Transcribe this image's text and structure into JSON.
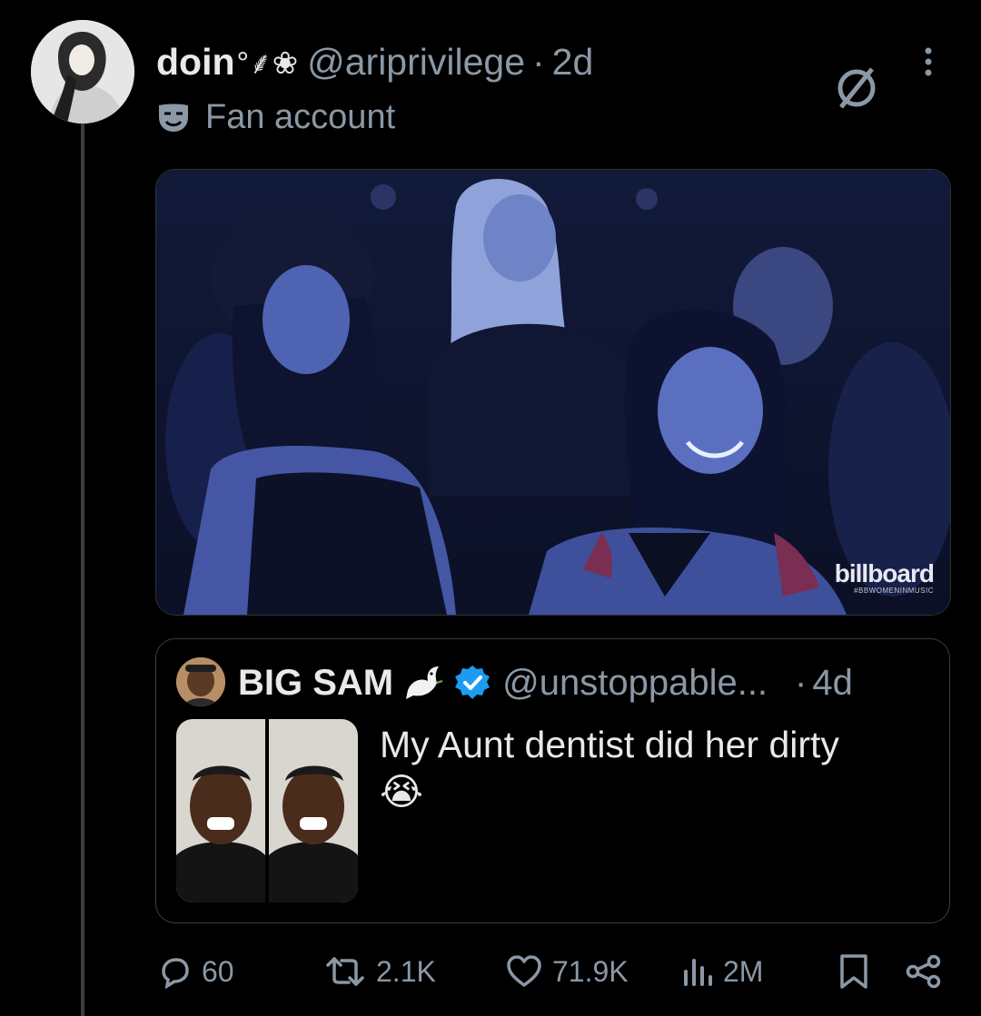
{
  "post": {
    "display_name": "doin",
    "name_decoration": "°⸙❀",
    "handle": "@ariprivilege",
    "separator": "·",
    "time": "2d",
    "account_label": "Fan account",
    "media_watermark": "billboard",
    "media_watermark_sub": "#BBWOMENINMUSIC"
  },
  "quote": {
    "display_name": "BIG SAM",
    "handle": "@unstoppable...",
    "separator": "·",
    "time": "4d",
    "text": "My Aunt dentist did her dirty",
    "emoji": "😭"
  },
  "actions": {
    "replies": "60",
    "reposts": "2.1K",
    "likes": "71.9K",
    "views": "2M"
  },
  "colors": {
    "background": "#000000",
    "text": "#e7e9ea",
    "secondary": "#8b98a5",
    "border": "#3a3d41",
    "verified": "#1d9bf0"
  }
}
